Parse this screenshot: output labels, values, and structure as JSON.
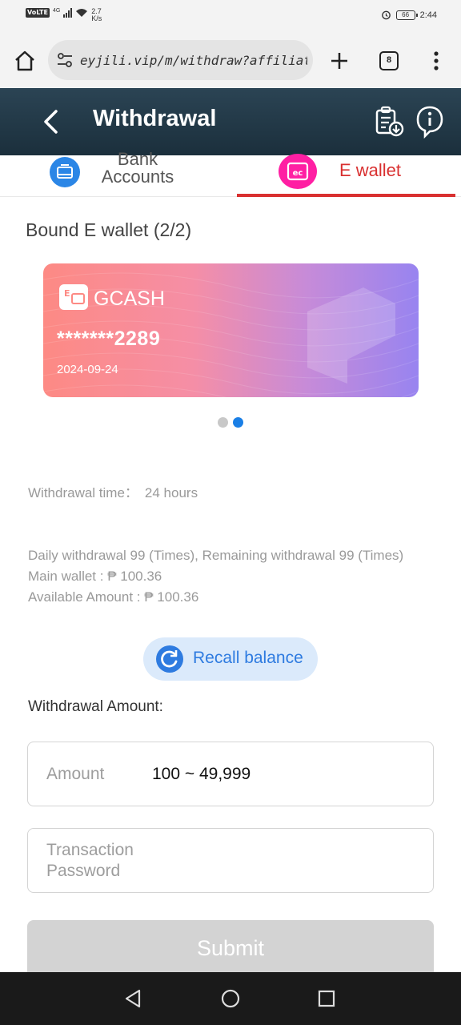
{
  "status_bar": {
    "network_badge": "VoLTE",
    "signal_type": "4G",
    "net_speed_value": "2.7",
    "net_speed_unit": "K/s",
    "battery": "66",
    "time": "2:44"
  },
  "browser": {
    "url": "eyjili.vip/m/withdraw?affiliate",
    "tab_count": "8"
  },
  "header": {
    "title": "Withdrawal"
  },
  "tabs": [
    {
      "label_line1": "Bank",
      "label_line2": "Accounts",
      "active": false
    },
    {
      "label": "E wallet",
      "active": true
    }
  ],
  "ewallet_section": {
    "title": "Bound E wallet (2/2)",
    "card": {
      "name": "GCASH",
      "number": "*******2289",
      "date": "2024-09-24"
    },
    "carousel_total": 2,
    "carousel_active": 2
  },
  "info": {
    "withdrawal_time_label": "Withdrawal time：",
    "withdrawal_time_value": "24 hours",
    "daily_limits": "Daily withdrawal 99 (Times), Remaining withdrawal 99 (Times)",
    "main_wallet": "Main wallet : ₱ 100.36",
    "available_amount": "Available Amount : ₱ 100.36"
  },
  "recall_button": "Recall balance",
  "form": {
    "amount_section_label": "Withdrawal Amount:",
    "amount_label": "Amount",
    "amount_range": "100 ~ 49,999",
    "password_placeholder": "Transaction Password",
    "submit_label": "Submit"
  },
  "colors": {
    "header_bg": "#1f3542",
    "accent_red": "#d93030",
    "accent_blue": "#2e7be0",
    "ewallet_pink": "#ff1fa3"
  }
}
